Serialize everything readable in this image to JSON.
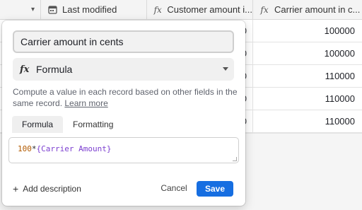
{
  "grid": {
    "columns": [
      {
        "label": "",
        "icon": "chevron-down-icon"
      },
      {
        "label": "Last modified",
        "icon": "calendar-icon"
      },
      {
        "label": "Customer amount i...",
        "icon": "formula-icon"
      },
      {
        "label": "Carrier amount in c...",
        "icon": "formula-icon"
      }
    ],
    "rows": [
      {
        "customer": "0",
        "carrier": "100000"
      },
      {
        "customer": "0",
        "carrier": "100000"
      },
      {
        "customer": "0",
        "carrier": "110000"
      },
      {
        "customer": "0",
        "carrier": "110000"
      },
      {
        "customer": "0",
        "carrier": "110000"
      }
    ]
  },
  "popup": {
    "field_name": "Carrier amount in cents",
    "type_icon": "formula-icon",
    "type_label": "Formula",
    "description": "Compute a value in each record based on other fields in the same record.",
    "learn_more": "Learn more",
    "tabs": [
      "Formula",
      "Formatting"
    ],
    "formula": {
      "number": "100",
      "operator": "*",
      "field": "{Carrier Amount}"
    },
    "add_description": "Add description",
    "cancel_label": "Cancel",
    "save_label": "Save"
  },
  "colors": {
    "accent": "#166ee1",
    "formula_field": "#7c3fd0",
    "formula_number": "#b25a00"
  }
}
